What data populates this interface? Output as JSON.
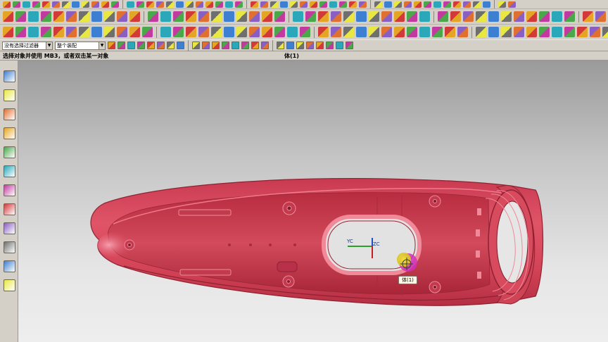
{
  "selection_bar": {
    "filter_label": "没有选择过滤器",
    "scope_label": "整个装配"
  },
  "status_bar": {
    "prompt": "选择对象并使用 MB3，或者双击某一对象",
    "selection": "体(1)"
  },
  "viewport": {
    "wcs_y_label": "YC",
    "wcs_z_label": "ZC",
    "hover_tooltip": "体(1)"
  },
  "colors": {
    "model_red": "#d9465a",
    "wcs_green": "#2aa02a",
    "highlight_magenta": "#d030b8",
    "highlight_yellow": "#f0ee20"
  },
  "icons": {
    "row1": [
      "new-icon",
      "open-icon",
      "save-icon",
      "print-icon",
      "cut-icon",
      "copy-icon",
      "paste-icon",
      "undo-icon",
      "redo-icon",
      "cube-icon",
      "cylinder-icon",
      "cone-icon",
      "sphere-icon",
      "block-icon",
      "edge-blend-icon",
      "chamfer-icon",
      "hole-icon",
      "boss-icon",
      "pocket-icon",
      "pad-icon",
      "slot-icon",
      "groove-icon",
      "shell-icon",
      "draft-icon",
      "extract-icon",
      "sew-icon",
      "trim-icon",
      "split-icon",
      "patch-icon",
      "offset-icon",
      "scale-icon",
      "wrap-icon",
      "unite-icon",
      "subtract-icon",
      "intersect-icon",
      "replace-icon",
      "move-face-icon",
      "resize-icon",
      "sync-icon",
      "delete-face-icon",
      "render-icon",
      "shade-icon",
      "wireframe-icon",
      "fit-icon",
      "zoom-icon",
      "rotate-icon",
      "pan-icon",
      "layer-icon",
      "view-icon",
      "snapshot-icon"
    ],
    "row2": [
      "line-icon",
      "arc-icon",
      "rectangle-icon",
      "spline-icon",
      "text-icon",
      "extrude-icon",
      "revolve-icon",
      "sweep-icon",
      "loft-icon",
      "mirror-icon",
      "pattern-icon",
      "fillet-icon",
      "measure-icon",
      "analysis-icon",
      "zoom-fit-icon",
      "view-front-icon",
      "view-top-icon",
      "view-right-icon",
      "view-iso-icon",
      "shaded-edges-icon",
      "shaded-icon",
      "wire-icon",
      "hidden-icon",
      "section-icon",
      "clip-icon",
      "lamp-icon",
      "camera-icon",
      "material-icon",
      "texture-icon",
      "mesh-icon",
      "curve-icon",
      "surface-icon",
      "body-icon",
      "face-icon",
      "edge-icon",
      "point-icon",
      "plane-icon",
      "axis-icon",
      "csys-icon",
      "datum-icon",
      "expression-icon",
      "part-nav-icon",
      "assembly-icon",
      "constraint-icon",
      "explode-icon",
      "bom-icon",
      "drawing-icon",
      "dim-icon",
      "note-icon",
      "table-icon"
    ],
    "row3": [
      "char-icon",
      "dim-horizontal-icon",
      "dim-vertical-icon",
      "dim-parallel-icon",
      "dim-perp-icon",
      "dim-angle-icon",
      "dim-radius-icon",
      "dim-diameter-icon",
      "cross-icon",
      "ordinate-icon",
      "baseline-icon",
      "chain-icon",
      "gdt-icon",
      "datum-feature-icon",
      "surface-finish-icon",
      "weld-icon",
      "balloon-icon",
      "centerline-icon",
      "symmetric-icon",
      "bolt-circle-icon",
      "leader-icon",
      "hatch-icon",
      "label-icon",
      "id-symbol-icon",
      "custom-symbol-icon",
      "table-note-icon",
      "parts-list-icon",
      "view-base-icon",
      "view-projected-icon",
      "view-detail-icon",
      "view-section-icon",
      "view-broken-icon",
      "view-aux-icon",
      "view-align-icon",
      "view-boundary-icon",
      "view-update-icon",
      "sheet-icon",
      "border-icon",
      "title-block-icon",
      "grid-icon",
      "list-icon",
      "hash-icon",
      "frame-icon",
      "square-icon",
      "box-icon",
      "bracket-icon",
      "angle-icon",
      "orient-icon",
      "layout-icon",
      "export-icon"
    ],
    "selection_bar": [
      "filter-icon",
      "select-all-icon",
      "select-type-icon",
      "snap-icon",
      "quick-pick-icon",
      "box-select-icon",
      "crossing-icon",
      "lasso-icon",
      "feature-icon",
      "body-select-icon",
      "face-select-icon",
      "curve-select-icon",
      "end-point-icon",
      "mid-point-icon",
      "control-point-icon",
      "intersection-icon",
      "arc-center-icon",
      "quadrant-icon",
      "existing-point-icon",
      "on-curve-icon",
      "on-surface-icon",
      "pole-icon",
      "point-on-curve-icon",
      "bounded-grid-icon"
    ],
    "resource_bar": [
      "part-navigator-icon",
      "assembly-navigator-icon",
      "constraint-navigator-icon",
      "reuse-library-icon",
      "web-browser-icon",
      "history-icon",
      "system-materials-icon",
      "process-studio-icon",
      "roles-icon",
      "visualization-icon",
      "manufacturing-icon",
      "palette-icon"
    ]
  }
}
